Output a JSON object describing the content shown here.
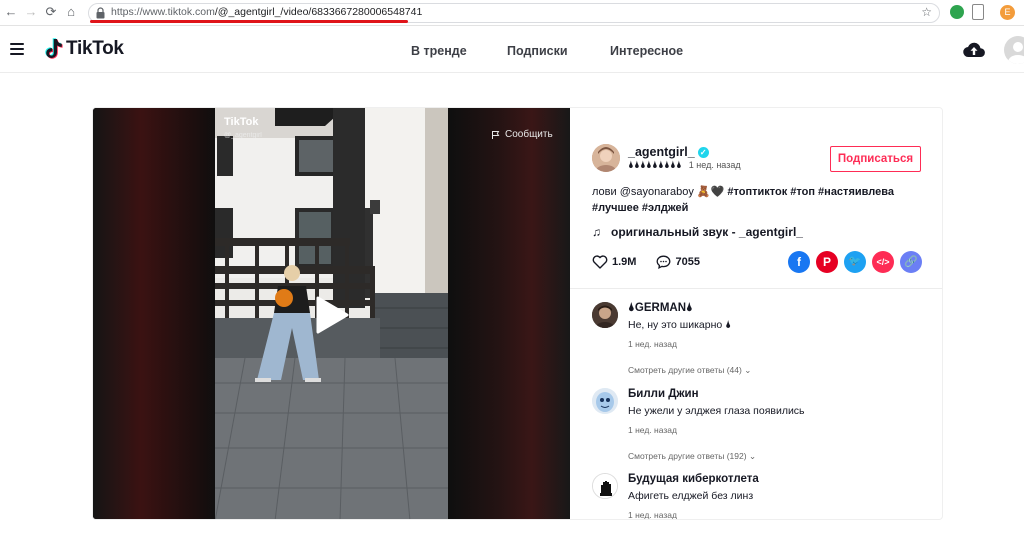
{
  "browser": {
    "url_host": "https://www.tiktok.com",
    "url_path": "/@_agentgirl_/video/6833667280006548741",
    "profile_initial": "E"
  },
  "header": {
    "logo_text": "TikTok",
    "nav": [
      "В тренде",
      "Подписки",
      "Интересное"
    ]
  },
  "video": {
    "watermark": "TikTok",
    "watermark_user": "@_agentgirl",
    "report_label": "Сообщить"
  },
  "post": {
    "author": "_agentgirl_",
    "nickname": "🌢🌢🌢🌢🌢🌢🌢🌢🌢",
    "time": "1 нед. назад",
    "follow_label": "Подписаться",
    "desc_plain": "лови @sayonaraboy 🧸🖤 ",
    "desc_tags": "#топтикток #топ #настяивлева #лучшее #элджей",
    "music": "оригинальный звук - _agentgirl_",
    "likes": "1.9M",
    "comments": "7055"
  },
  "share_icons": [
    "facebook-icon",
    "pinterest-icon",
    "twitter-icon",
    "embed-icon",
    "link-icon"
  ],
  "comments": [
    {
      "name": "🌢GERMAN🌢",
      "text": "Не, ну это шикарно 🌢",
      "time": "1 нед. назад",
      "more": "Смотреть другие ответы (44)"
    },
    {
      "name": "Билли Джин",
      "text": "Не ужели у элджея глаза появились",
      "time": "1 нед. назад",
      "more": "Смотреть другие ответы (192)"
    },
    {
      "name": "Будущая киберкотлета",
      "text": "Афигеть елджей без линз",
      "time": "1 нед. назад",
      "more": ""
    }
  ],
  "colors": {
    "accent": "#fe2c55",
    "verified": "#20d5ec",
    "facebook": "#1877f2",
    "pinterest": "#e60023",
    "twitter": "#1da1f2",
    "embed": "#fe2c55",
    "link": "#6b7ff5"
  }
}
